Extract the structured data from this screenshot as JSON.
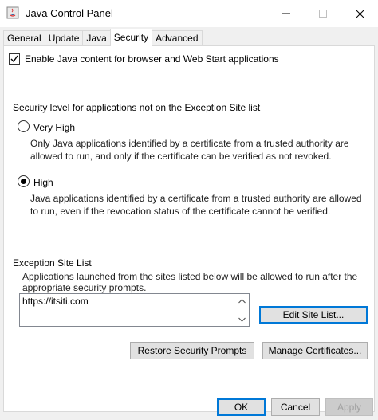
{
  "window": {
    "title": "Java Control Panel",
    "icon": "java-coffee-icon"
  },
  "tabs": [
    {
      "label": "General",
      "active": false
    },
    {
      "label": "Update",
      "active": false
    },
    {
      "label": "Java",
      "active": false
    },
    {
      "label": "Security",
      "active": true
    },
    {
      "label": "Advanced",
      "active": false
    }
  ],
  "security": {
    "enable_checkbox_label": "Enable Java content for browser and Web Start applications",
    "enable_checked": true,
    "level_heading": "Security level for applications not on the Exception Site list",
    "very_high": {
      "label": "Very High",
      "selected": false,
      "description_line1": "Only Java applications identified by a certificate from a trusted authority are",
      "description_line2": "allowed to run, and only if the certificate can be verified as not revoked."
    },
    "high": {
      "label": "High",
      "selected": true,
      "description_line1": "Java applications identified by a certificate from a trusted authority are allowed",
      "description_line2": "to run, even if the revocation status of the certificate cannot be verified."
    },
    "exception_heading": "Exception Site List",
    "exception_description_line1": "Applications launched from the sites listed below will be allowed to run after the",
    "exception_description_line2": "appropriate security prompts.",
    "sites": [
      "https://itsiti.com"
    ],
    "edit_site_list_label": "Edit Site List...",
    "restore_prompts_label": "Restore Security Prompts",
    "manage_certificates_label": "Manage Certificates..."
  },
  "footer": {
    "ok_label": "OK",
    "cancel_label": "Cancel",
    "apply_label": "Apply"
  }
}
